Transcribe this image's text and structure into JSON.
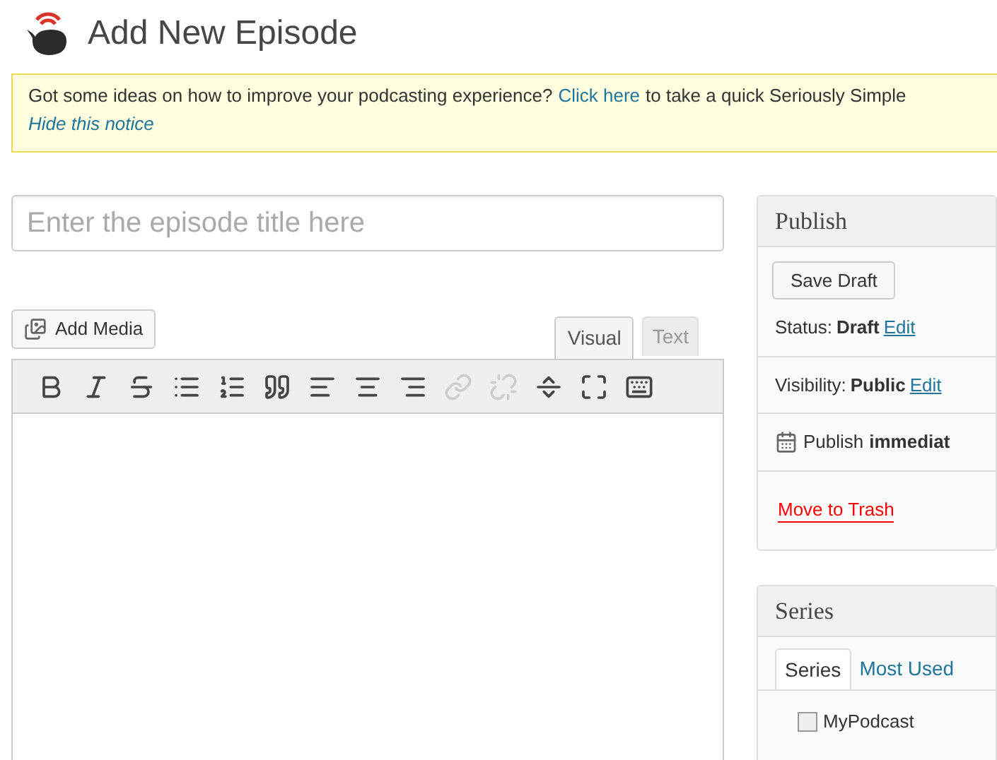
{
  "page_title": "Add New Episode",
  "notice": {
    "lead": "Got some ideas on how to improve your podcasting experience?",
    "link": "Click here",
    "trail": "to take a quick Seriously Simple",
    "dismiss": "Hide this notice"
  },
  "title_field": {
    "placeholder": "Enter the episode title here"
  },
  "add_media": "Add Media",
  "editor_tabs": [
    {
      "label": "Visual",
      "selected": true
    },
    {
      "label": "Text",
      "selected": false
    }
  ],
  "toolbar": [
    {
      "kind": "bold",
      "disabled": false
    },
    {
      "kind": "italic",
      "disabled": false
    },
    {
      "kind": "strike",
      "disabled": false
    },
    {
      "kind": "bullets",
      "disabled": false
    },
    {
      "kind": "numbers",
      "disabled": false
    },
    {
      "kind": "quote",
      "disabled": false
    },
    {
      "kind": "left",
      "disabled": false
    },
    {
      "kind": "center",
      "disabled": false
    },
    {
      "kind": "right",
      "disabled": false
    },
    {
      "kind": "link",
      "disabled": true
    },
    {
      "kind": "unlink",
      "disabled": true
    },
    {
      "kind": "more",
      "disabled": false
    },
    {
      "kind": "fullscreen",
      "disabled": false
    },
    {
      "kind": "kitchen",
      "disabled": false
    }
  ],
  "publish": {
    "title": "Publish",
    "save_draft": "Save Draft",
    "status_label": "Status:",
    "status_value": "Draft",
    "status_edit": "Edit",
    "visibility_label": "Visibility:",
    "visibility_value": "Public",
    "visibility_edit": "Edit",
    "schedule_label": "Publish",
    "schedule_value": "immediat",
    "trash": "Move to Trash"
  },
  "series": {
    "title": "Series",
    "tabs": [
      {
        "label": "Series",
        "selected": true
      },
      {
        "label": "Most Used",
        "selected": false
      }
    ],
    "items": [
      {
        "label": "MyPodcast",
        "checked": false
      }
    ]
  }
}
